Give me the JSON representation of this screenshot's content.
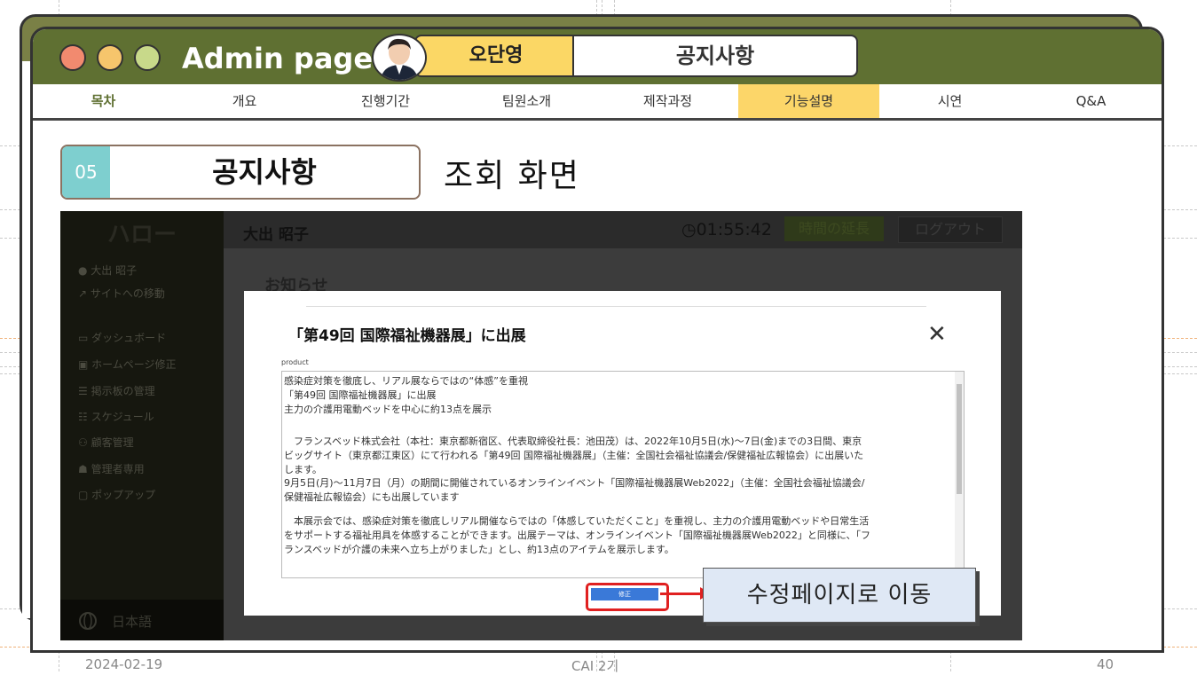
{
  "window": {
    "title": "Admin page",
    "presenter": "오단영",
    "section": "공지사항"
  },
  "nav": {
    "items": [
      "목차",
      "개요",
      "진행기간",
      "팀원소개",
      "제작과정",
      "기능설명",
      "시연",
      "Q&A"
    ],
    "active_index": 5
  },
  "section": {
    "number": "05",
    "name": "공지사항",
    "subtitle": "조회 화면"
  },
  "screenshot": {
    "sidebar": {
      "brand": "ハロー",
      "user": "大出 昭子",
      "site_link": "サイトへの移動",
      "items": [
        "ダッシュボード",
        "ホームページ修正",
        "掲示板の管理",
        "スケジュール",
        "顧客管理",
        "管理者専用",
        "ポップアップ"
      ],
      "language": "日本語"
    },
    "topbar": {
      "user": "大出 昭子",
      "timer": "01:55:42",
      "extend_button": "時間の延長",
      "logout_button": "ログアウト"
    },
    "background_title": "お知らせ",
    "modal": {
      "title": "「第49回 国際福祉機器展」に出展",
      "product_label": "product",
      "body_lines": [
        "感染症対策を徹底し、リアル展ならではの“体感”を重視",
        "「第49回 国際福祉機器展」に出展",
        "主力の介護用電動ベッドを中心に約13点を展示",
        "",
        "　フランスベッド株式会社（本社：東京都新宿区、代表取締役社長：池田茂）は、2022年10月5日(水)～7日(金)までの3日間、東京",
        "ビッグサイト（東京都江東区）にて行われる「第49回 国際福祉機器展」（主催：全国社会福祉協議会/保健福祉広報協会）に出展いた",
        "します。",
        "9月5日(月)～11月7日（月）の期間に開催されているオンラインイベント「国際福祉機器展Web2022」（主催：全国社会福祉協議会/",
        "保健福祉広報協会）にも出展しています",
        "",
        "　本展示会では、感染症対策を徹底しリアル開催ならではの「体感していただくこと」を重視し、主力の介護用電動ベッドや日常生活",
        "をサポートする福祉用具を体感することができます。出展テーマは、オンラインイベント「国際福祉機器展Web2022」と同様に、「フ",
        "ランスベッドが介護の未来へ立ち上がりました」とし、約13点のアイテムを展示します。"
      ],
      "edit_button": "修正",
      "close_icon": "close-icon"
    }
  },
  "callout": "수정페이지로 이동",
  "footer": {
    "date": "2024-02-19",
    "center": "CAI 2기",
    "page": "40"
  },
  "colors": {
    "title_bar": "#5f7032",
    "accent_yellow": "#fcd669",
    "section_number": "#7ecfcf",
    "highlight_red": "#e02020",
    "callout_bg": "#dfe8f5"
  }
}
